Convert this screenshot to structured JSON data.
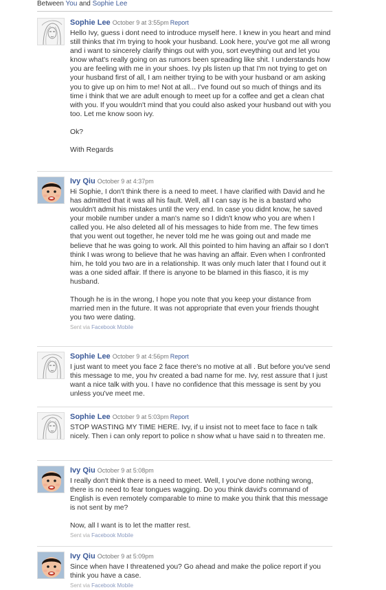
{
  "header": {
    "prefix": "Between",
    "you": "You",
    "and": "and",
    "other": "Sophie Lee"
  },
  "messages": [
    {
      "sender": "Sophie Lee",
      "date": "October 9 at 3:55pm",
      "report": "Report",
      "avatar": "sketch-portrait-icon",
      "paragraphs": [
        "Hello Ivy, guess i dont need to introduce myself here. I knew in you heart and mind still thinks that i'm trying to hook your husband. Look here, you've got me all wrong and i want to sincerely clarify things out with you, sort eveything out and let you know what's really going on as rumors been spreading like shit. I understands how you are feeling with me in your shoes. Ivy pls listen up that I'm not trying to get on your husband first of all, I am neither trying to be with your husband or am asking you to give up on him to me! Not at all... I've found out so much of things and its time i think that we are adult enough to meet up for a coffee and get a clean chat with you. If you wouldn't mind that you could also asked your husband out with you too. Let me know soon ivy.",
        "Ok?",
        "With Regards"
      ]
    },
    {
      "sender": "Ivy Qiu",
      "date": "October 9 at 4:37pm",
      "avatar": "baby-photo-icon",
      "paragraphs": [
        "Hi Sophie, I don't think there is a need to meet. I have clarified with David and he has admitted that it was all his fault. Well, all I can say is he is a bastard who wouldn't admit his mistakes until the very end. In case you didnt know, he saved your mobile number under a man's name so I didn't know who you are when I called you. He also deleted all of his messages to hide from me. The few times that you went out together, he never told me he was going out and made me believe that he was going to work. All this pointed to him having an affair so I don't think I was wrong to believe that he was having an affair. Even when I confronted him, he told you two are in a relationship. It was only much later that I found out it was a one sided affair. If there is anyone to be blamed in this fiasco, it is my husband.",
        "Though he is in the wrong, I hope you note that you keep your distance from married men in the future. It was not appropriate that even your friends thought you two were dating."
      ],
      "sent_via": "Sent via",
      "sent_link": "Facebook Mobile"
    },
    {
      "sender": "Sophie Lee",
      "date": "October 9 at 4:56pm",
      "report": "Report",
      "avatar": "sketch-portrait-icon",
      "paragraphs": [
        "I just want to meet you face 2 face there's no motive at all . But before you've send this message to me, you hv created a bad name for me. Ivy, rest assure that I just want a nice talk with you. I have no confidence that this message is sent by you unless you've meet me."
      ]
    },
    {
      "sender": "Sophie Lee",
      "date": "October 9 at 5:03pm",
      "report": "Report",
      "avatar": "sketch-portrait-icon",
      "paragraphs": [
        "STOP WASTING MY TIME HERE. Ivy, if u insist not to meet face to face n talk nicely. Then i can only report to police n show what u have said n to threaten me."
      ]
    },
    {
      "sender": "Ivy Qiu",
      "date": "October 9 at 5:08pm",
      "avatar": "baby-photo-icon",
      "paragraphs": [
        "I really don't think there is a need to meet. Well, I you've done nothing wrong, there is no need to fear tongues wagging. Do you think david's command of English is even remotely comparable to mine to make you think that this message is not sent by me?",
        "Now, all I want is to let the matter rest."
      ],
      "sent_via": "Sent via",
      "sent_link": "Facebook Mobile"
    },
    {
      "sender": "Ivy Qiu",
      "date": "October 9 at 5:09pm",
      "avatar": "baby-photo-icon",
      "paragraphs": [
        "Since when have I threatened you? Go ahead and make the police report if you think you have a case."
      ],
      "sent_via": "Sent via",
      "sent_link": "Facebook Mobile"
    }
  ]
}
